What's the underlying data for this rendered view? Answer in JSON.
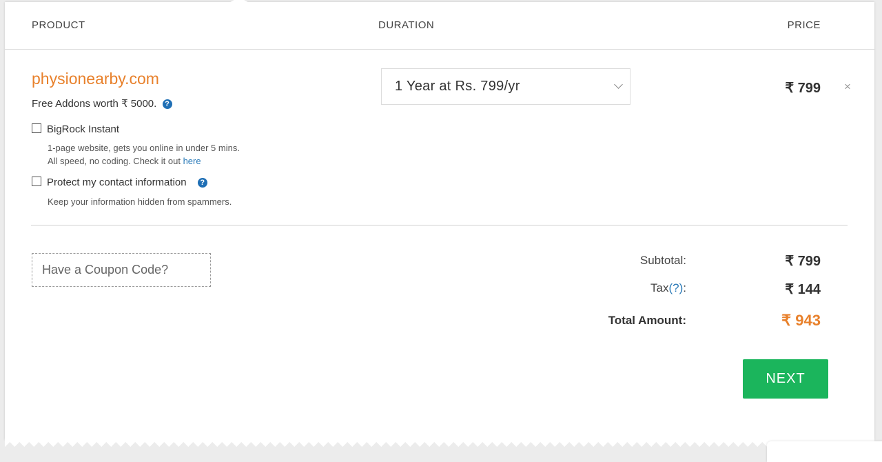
{
  "table_header": {
    "product": "PRODUCT",
    "duration": "DURATION",
    "price": "PRICE"
  },
  "item": {
    "domain": "physionearby.com",
    "addons_text": "Free Addons worth ₹ 5000.",
    "help_icon": "question-circle-icon",
    "duration_select": "1 Year at Rs. 799/yr",
    "price": "₹ 799",
    "remove_icon": "×"
  },
  "addons": [
    {
      "label": "BigRock Instant",
      "checked": false,
      "desc_line1": "1-page website, gets you online in under 5 mins.",
      "desc_line2": "All speed, no coding. Check it out ",
      "link": "here"
    },
    {
      "label": "Protect my contact information",
      "checked": false,
      "desc_line1": "Keep your information hidden from spammers."
    }
  ],
  "coupon": {
    "placeholder": "Have a Coupon Code?"
  },
  "summary": {
    "subtotal_label": "Subtotal:",
    "subtotal_value": "₹ 799",
    "tax_label": "Tax",
    "tax_help": "(?)",
    "tax_colon": ":",
    "tax_value": "₹ 144",
    "total_label": "Total Amount:",
    "total_value": "₹ 943"
  },
  "actions": {
    "next_label": "NEXT"
  },
  "colors": {
    "accent_orange": "#e8812c",
    "next_green": "#1bb55c",
    "link_blue": "#2a7ab8"
  }
}
